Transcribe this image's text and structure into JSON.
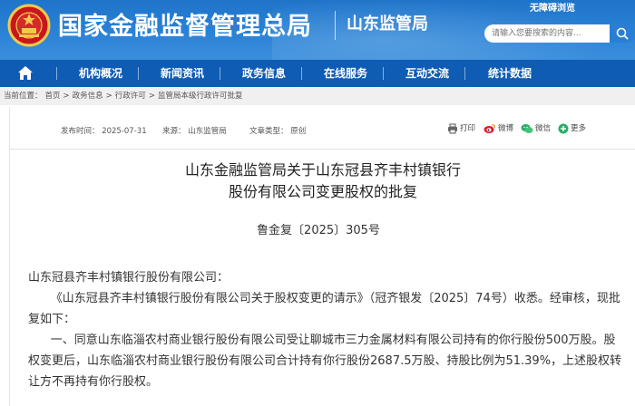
{
  "header": {
    "site_title": "国家金融监督管理总局",
    "sub_title": "山东监管局",
    "top_link": "无障碍浏览",
    "search_placeholder": "请输入您要搜索的内容..."
  },
  "nav": {
    "items": [
      "机构概况",
      "新闻资讯",
      "政务信息",
      "在线服务",
      "互动交流",
      "统计数据"
    ]
  },
  "breadcrumb": {
    "label": "当前位置：",
    "items": [
      "首页",
      "政务信息",
      "行政许可",
      "监管局本级行政许可批复"
    ],
    "separator": ">"
  },
  "meta": {
    "date": "发布时间： 2025-07-31",
    "source": "来源： 山东监管局",
    "type": "文章类型： 原创",
    "share": [
      "打印",
      "微博",
      "微信",
      "更多"
    ]
  },
  "document": {
    "title_line1": "山东金融监管局关于山东冠县齐丰村镇银行",
    "title_line2": "股份有限公司变更股权的批复",
    "number": "鲁金复〔2025〕305号",
    "addressee": "山东冠县齐丰村镇银行股份有限公司：",
    "para1": "《山东冠县齐丰村镇银行股份有限公司关于股权变更的请示》（冠齐银发〔2025〕74号）收悉。经审核，现批复如下：",
    "para2": "一、同意山东临淄农村商业银行股份有限公司受让聊城市三力金属材料有限公司持有的你行股份500万股。股权变更后，山东临淄农村商业银行股份有限公司合计持有你行股份2687.5万股、持股比例为51.39%，上述股权转让方不再持有你行股权。"
  },
  "colors": {
    "header_blue": "#2a82d6",
    "nav_blue": "#0f5cb5",
    "breadcrumb_bg": "#f0f0f0"
  }
}
